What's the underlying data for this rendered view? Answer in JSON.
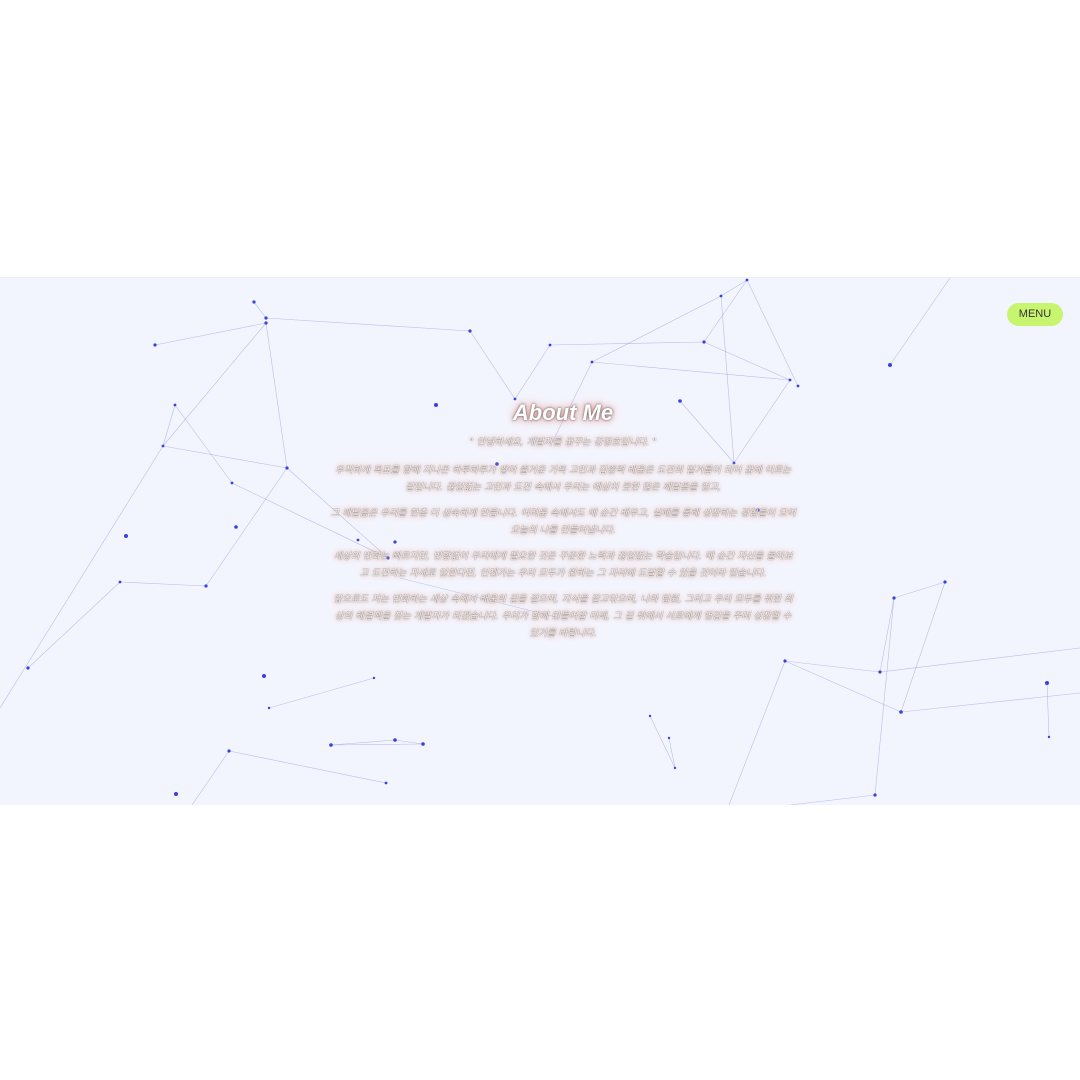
{
  "menu": {
    "label": "MENU"
  },
  "about": {
    "title": "About Me",
    "greeting": "\" 안녕하세요, 개발자를 꿈꾸는 강정호입니다. \"",
    "paragraphs": [
      "우직하게 목표를 향해 지나온 하루하루가 쌓여 즐거운 가득 고민과 집중력 배움은 도전의 밑거름이 되어 꿈에 이르는 길입니다. 끊임없는 고민과 도전 속에서 우리는 예상치 못한 많은 깨달음을 얻고,",
      "그 깨달음은 우리를 한층 더 성숙하게 만듭니다. 어려움 속에서도 매 순간 배우고, 실패를 통해 성장하는 경험들이 모여 오늘의 나를 만들어냅니다.",
      "세상의 변화는 빠르지만, 변함없이 우리에게 필요한 것은 꾸준한 노력과 끊임없는 학습입니다. 매 순간 자신을 돌아보고 도전하는 자세로 임한다면, 언젠가는 우리 모두가 원하는 그 자리에 도달할 수 있을 것이라 믿습니다.",
      "앞으로도 저는 변화하는 세상 속에서 배움의 길을 걸으며, 지식을 갈고닦으며, 나와 팀원, 그리고 우리 모두를 위한 최상의 해결책을 찾는 개발자가 되겠습니다. 우리가 함께 만들어갈 미래, 그 길 위에서 서로에게 영감을 주며 성장할 수 있기를 바랍니다."
    ]
  }
}
